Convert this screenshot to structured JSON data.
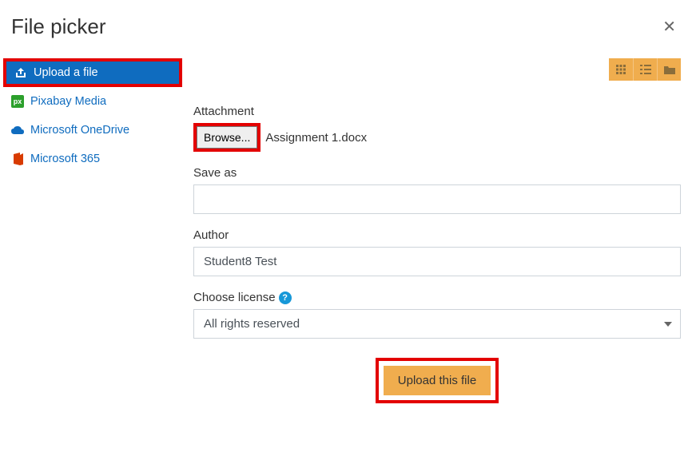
{
  "header": {
    "title": "File picker"
  },
  "sidebar": {
    "items": [
      {
        "label": "Upload a file",
        "icon": "upload",
        "active": true
      },
      {
        "label": "Pixabay Media",
        "icon": "pixabay",
        "active": false
      },
      {
        "label": "Microsoft OneDrive",
        "icon": "onedrive",
        "active": false
      },
      {
        "label": "Microsoft 365",
        "icon": "m365",
        "active": false
      }
    ]
  },
  "form": {
    "attachment_label": "Attachment",
    "browse_label": "Browse...",
    "selected_file": "Assignment 1.docx",
    "saveas_label": "Save as",
    "saveas_value": "",
    "author_label": "Author",
    "author_value": "Student8 Test",
    "license_label": "Choose license",
    "license_value": "All rights reserved",
    "upload_label": "Upload this file"
  }
}
